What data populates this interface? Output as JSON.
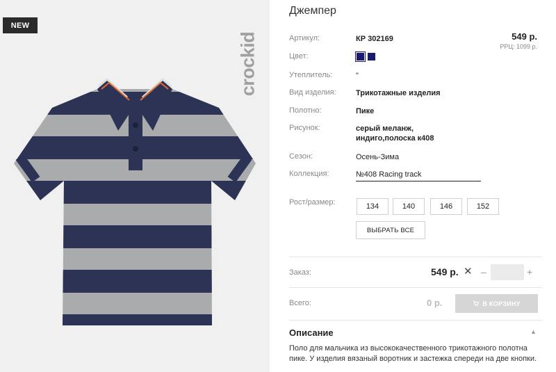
{
  "product": {
    "title": "Джемпер",
    "badge": "NEW",
    "brand": "crockid",
    "price": "549 р.",
    "rrp": "РРЦ: 1099 р."
  },
  "attributes": [
    {
      "label": "Артикул:",
      "value": "КР 302169"
    },
    {
      "label": "Цвет:",
      "value": ""
    },
    {
      "label": "Утеплитель:",
      "value": "\""
    },
    {
      "label": "Вид изделия:",
      "value": "Трикотажные изделия"
    },
    {
      "label": "Полотно:",
      "value": "Пике"
    },
    {
      "label": "Рисунок:",
      "value": "серый меланж, индиго,полоска к408"
    },
    {
      "label": "Сезон:",
      "value": "Осень-Зима"
    },
    {
      "label": "Коллекция:",
      "value": "№408 Racing track"
    }
  ],
  "colors": [
    "#1a1a6e",
    "#1a1a6e"
  ],
  "sizes": {
    "label": "Рост/размер:",
    "options": [
      "134",
      "140",
      "146",
      "152"
    ],
    "select_all": "ВЫБРАТЬ ВСЕ"
  },
  "order": {
    "label": "Заказ:",
    "price": "549 р.",
    "times": "✕",
    "minus": "–",
    "plus": "+",
    "quantity": ""
  },
  "total": {
    "label": "Всего:",
    "value": "0 р.",
    "cart_button": "В КОРЗИНУ",
    "cart_icon": "cart-icon"
  },
  "description": {
    "title": "Описание",
    "caret": "▲",
    "text": "Поло для мальчика из высококачественного трикотажного полотна пике. У изделия вязаный воротник и застежка спереди на две кнопки."
  }
}
